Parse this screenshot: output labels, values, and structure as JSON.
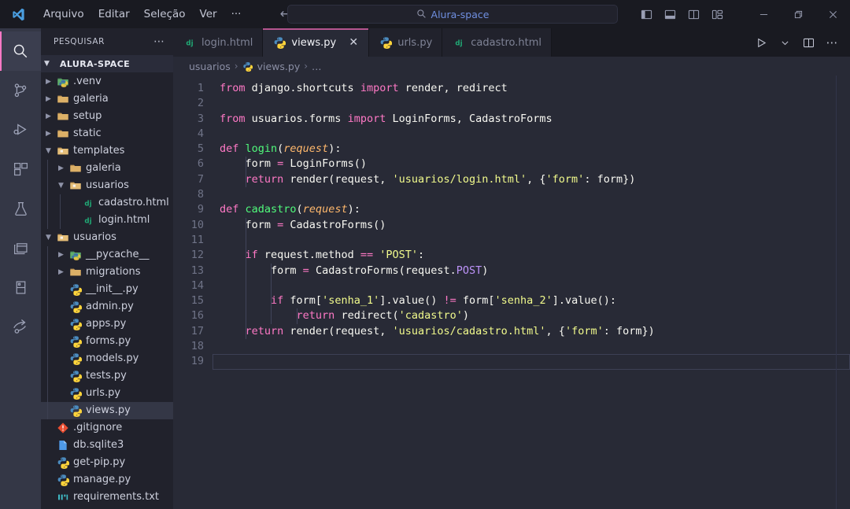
{
  "titlebar": {
    "logo_icon": "vscode-logo-icon",
    "menu": [
      "Arquivo",
      "Editar",
      "Seleção",
      "Ver",
      "···"
    ],
    "nav_back_icon": "arrow-left-icon",
    "nav_forward_icon": "arrow-right-icon",
    "search": {
      "icon": "search-icon",
      "value": "Alura-space"
    },
    "layout_icons": [
      "toggle-primary-sidebar-icon",
      "toggle-panel-icon",
      "toggle-secondary-sidebar-icon",
      "customize-layout-icon"
    ],
    "window_controls": {
      "minimize": "—",
      "restore": "restore-icon",
      "close": "✕"
    }
  },
  "activitybar": {
    "items": [
      {
        "name": "search",
        "icon": "search-icon",
        "active": true
      },
      {
        "name": "source-control",
        "icon": "source-control-icon",
        "active": false
      },
      {
        "name": "run-and-debug",
        "icon": "run-debug-icon",
        "active": false
      },
      {
        "name": "extensions",
        "icon": "extensions-icon",
        "active": false
      },
      {
        "name": "testing",
        "icon": "flask-icon",
        "active": false
      },
      {
        "name": "remote-explorer",
        "icon": "windows-stack-icon",
        "active": false
      },
      {
        "name": "database",
        "icon": "database-panel-icon",
        "active": false
      },
      {
        "name": "live-share",
        "icon": "share-arrow-icon",
        "active": false
      }
    ]
  },
  "sidebar": {
    "header_title": "PESQUISAR",
    "header_more_icon": "more-actions-icon",
    "root_label": "ALURA-SPACE",
    "root_expanded": true,
    "tree": [
      {
        "label": ".venv",
        "icon": "python-folder-icon",
        "depth": 1,
        "type": "folder",
        "expanded": false
      },
      {
        "label": "galeria",
        "icon": "folder-icon",
        "depth": 1,
        "type": "folder",
        "expanded": false
      },
      {
        "label": "setup",
        "icon": "folder-icon",
        "depth": 1,
        "type": "folder",
        "expanded": false
      },
      {
        "label": "static",
        "icon": "folder-icon",
        "depth": 1,
        "type": "folder",
        "expanded": false
      },
      {
        "label": "templates",
        "icon": "folder-open-icon",
        "depth": 1,
        "type": "folder",
        "expanded": true
      },
      {
        "label": "galeria",
        "icon": "folder-icon",
        "depth": 2,
        "type": "folder",
        "expanded": false
      },
      {
        "label": "usuarios",
        "icon": "folder-open-icon",
        "depth": 2,
        "type": "folder",
        "expanded": true
      },
      {
        "label": "cadastro.html",
        "icon": "django-icon",
        "depth": 3,
        "type": "file"
      },
      {
        "label": "login.html",
        "icon": "django-icon",
        "depth": 3,
        "type": "file"
      },
      {
        "label": "usuarios",
        "icon": "folder-open-icon",
        "depth": 1,
        "type": "folder",
        "expanded": true
      },
      {
        "label": "__pycache__",
        "icon": "python-folder-icon",
        "depth": 2,
        "type": "folder",
        "expanded": false
      },
      {
        "label": "migrations",
        "icon": "folder-icon",
        "depth": 2,
        "type": "folder",
        "expanded": false
      },
      {
        "label": "__init__.py",
        "icon": "python-icon",
        "depth": 2,
        "type": "file"
      },
      {
        "label": "admin.py",
        "icon": "python-icon",
        "depth": 2,
        "type": "file"
      },
      {
        "label": "apps.py",
        "icon": "python-icon",
        "depth": 2,
        "type": "file"
      },
      {
        "label": "forms.py",
        "icon": "python-icon",
        "depth": 2,
        "type": "file"
      },
      {
        "label": "models.py",
        "icon": "python-icon",
        "depth": 2,
        "type": "file"
      },
      {
        "label": "tests.py",
        "icon": "python-icon",
        "depth": 2,
        "type": "file"
      },
      {
        "label": "urls.py",
        "icon": "python-icon",
        "depth": 2,
        "type": "file"
      },
      {
        "label": "views.py",
        "icon": "python-icon",
        "depth": 2,
        "type": "file",
        "selected": true
      },
      {
        "label": ".gitignore",
        "icon": "git-icon",
        "depth": 1,
        "type": "file"
      },
      {
        "label": "db.sqlite3",
        "icon": "database-file-icon",
        "depth": 1,
        "type": "file"
      },
      {
        "label": "get-pip.py",
        "icon": "python-icon",
        "depth": 1,
        "type": "file"
      },
      {
        "label": "manage.py",
        "icon": "python-icon",
        "depth": 1,
        "type": "file"
      },
      {
        "label": "requirements.txt",
        "icon": "requirements-icon",
        "depth": 1,
        "type": "file"
      }
    ]
  },
  "editor": {
    "tabs": [
      {
        "label": "login.html",
        "icon": "django-icon",
        "active": false,
        "closable": false
      },
      {
        "label": "views.py",
        "icon": "python-icon",
        "active": true,
        "closable": true,
        "close_icon": "close-icon"
      },
      {
        "label": "urls.py",
        "icon": "python-icon",
        "active": false,
        "closable": false
      },
      {
        "label": "cadastro.html",
        "icon": "django-icon",
        "active": false,
        "closable": false
      }
    ],
    "actions": [
      {
        "name": "run-python-file",
        "icon": "play-icon"
      },
      {
        "name": "run-options",
        "icon": "chevron-down-icon"
      },
      {
        "name": "split-editor",
        "icon": "split-editor-icon"
      },
      {
        "name": "more-actions",
        "icon": "more-actions-icon"
      }
    ],
    "breadcrumb": {
      "folder": "usuarios",
      "file": "views.py",
      "file_icon": "python-icon",
      "more": "…",
      "sep": "›"
    },
    "line_numbers": [
      1,
      2,
      3,
      4,
      5,
      6,
      7,
      8,
      9,
      10,
      11,
      12,
      13,
      14,
      15,
      16,
      17,
      18,
      19
    ],
    "current_line": 19,
    "lines": [
      [
        {
          "t": "from ",
          "c": "k"
        },
        {
          "t": "django.shortcuts ",
          "c": "pl"
        },
        {
          "t": "import ",
          "c": "k"
        },
        {
          "t": "render, redirect",
          "c": "pl"
        }
      ],
      [],
      [
        {
          "t": "from ",
          "c": "k"
        },
        {
          "t": "usuarios.forms ",
          "c": "pl"
        },
        {
          "t": "import ",
          "c": "k"
        },
        {
          "t": "LoginForms, CadastroForms",
          "c": "pl"
        }
      ],
      [],
      [
        {
          "t": "def ",
          "c": "k"
        },
        {
          "t": "login",
          "c": "fn"
        },
        {
          "t": "(",
          "c": "pl"
        },
        {
          "t": "request",
          "c": "pa"
        },
        {
          "t": "):",
          "c": "pl"
        }
      ],
      [
        {
          "t": "    form ",
          "c": "pl"
        },
        {
          "t": "=",
          "c": "op"
        },
        {
          "t": " LoginForms()",
          "c": "pl"
        }
      ],
      [
        {
          "t": "    ",
          "c": "pl"
        },
        {
          "t": "return ",
          "c": "k"
        },
        {
          "t": "render(request, ",
          "c": "pl"
        },
        {
          "t": "'usuarios/login.html'",
          "c": "st"
        },
        {
          "t": ", {",
          "c": "pl"
        },
        {
          "t": "'form'",
          "c": "st"
        },
        {
          "t": ": form})",
          "c": "pl"
        }
      ],
      [],
      [
        {
          "t": "def ",
          "c": "k"
        },
        {
          "t": "cadastro",
          "c": "fn"
        },
        {
          "t": "(",
          "c": "pl"
        },
        {
          "t": "request",
          "c": "pa"
        },
        {
          "t": "):",
          "c": "pl"
        }
      ],
      [
        {
          "t": "    form ",
          "c": "pl"
        },
        {
          "t": "=",
          "c": "op"
        },
        {
          "t": " CadastroForms()",
          "c": "pl"
        }
      ],
      [],
      [
        {
          "t": "    ",
          "c": "pl"
        },
        {
          "t": "if ",
          "c": "k"
        },
        {
          "t": "request.method ",
          "c": "pl"
        },
        {
          "t": "==",
          "c": "op"
        },
        {
          "t": " ",
          "c": "pl"
        },
        {
          "t": "'POST'",
          "c": "st"
        },
        {
          "t": ":",
          "c": "pl"
        }
      ],
      [
        {
          "t": "        form ",
          "c": "pl"
        },
        {
          "t": "=",
          "c": "op"
        },
        {
          "t": " CadastroForms(request.",
          "c": "pl"
        },
        {
          "t": "POST",
          "c": "pu"
        },
        {
          "t": ")",
          "c": "pl"
        }
      ],
      [],
      [
        {
          "t": "        ",
          "c": "pl"
        },
        {
          "t": "if ",
          "c": "k"
        },
        {
          "t": "form[",
          "c": "pl"
        },
        {
          "t": "'senha_1'",
          "c": "st"
        },
        {
          "t": "].value() ",
          "c": "pl"
        },
        {
          "t": "!=",
          "c": "op"
        },
        {
          "t": " form[",
          "c": "pl"
        },
        {
          "t": "'senha_2'",
          "c": "st"
        },
        {
          "t": "].value():",
          "c": "pl"
        }
      ],
      [
        {
          "t": "            ",
          "c": "pl"
        },
        {
          "t": "return ",
          "c": "k"
        },
        {
          "t": "redirect(",
          "c": "pl"
        },
        {
          "t": "'cadastro'",
          "c": "st"
        },
        {
          "t": ")",
          "c": "pl"
        }
      ],
      [
        {
          "t": "    ",
          "c": "pl"
        },
        {
          "t": "return ",
          "c": "k"
        },
        {
          "t": "render(request, ",
          "c": "pl"
        },
        {
          "t": "'usuarios/cadastro.html'",
          "c": "st"
        },
        {
          "t": ", {",
          "c": "pl"
        },
        {
          "t": "'form'",
          "c": "st"
        },
        {
          "t": ": form})",
          "c": "pl"
        }
      ],
      [],
      []
    ],
    "indent_guides": [
      {
        "line": 6,
        "cols": [
          1
        ]
      },
      {
        "line": 7,
        "cols": [
          1
        ]
      },
      {
        "line": 10,
        "cols": [
          1
        ]
      },
      {
        "line": 11,
        "cols": [
          1
        ]
      },
      {
        "line": 12,
        "cols": [
          1
        ]
      },
      {
        "line": 13,
        "cols": [
          1,
          2
        ]
      },
      {
        "line": 14,
        "cols": [
          1,
          2
        ]
      },
      {
        "line": 15,
        "cols": [
          1,
          2
        ]
      },
      {
        "line": 16,
        "cols": [
          1,
          2,
          3
        ]
      },
      {
        "line": 17,
        "cols": [
          1
        ]
      }
    ]
  },
  "colors": {
    "editor_bg": "#282a36",
    "sidebar_bg": "#21222c",
    "activitybar_bg": "#343746",
    "titlebar_bg": "#191a21",
    "accent_pink": "#ff79c6",
    "string_yellow": "#f1fa8c",
    "function_green": "#50fa7b",
    "param_orange": "#ffb86c",
    "purple": "#bd93f9"
  }
}
